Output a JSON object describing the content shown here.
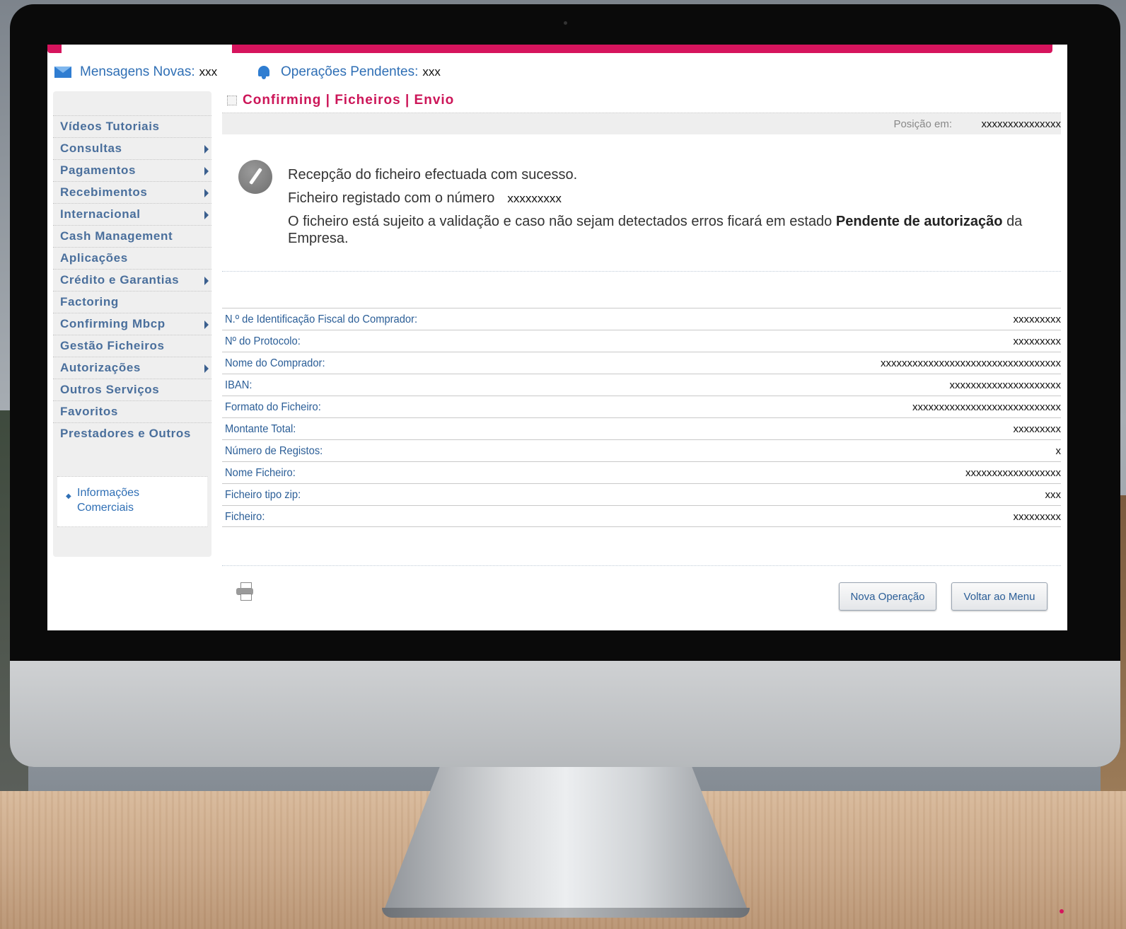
{
  "header": {
    "messages_label": "Mensagens Novas:",
    "messages_value": "xxx",
    "pending_label": "Operações Pendentes:",
    "pending_value": "xxx"
  },
  "page": {
    "title": "Confirming | Ficheiros | Envio",
    "position_label": "Posição em:",
    "position_value": "xxxxxxxxxxxxxxx"
  },
  "sidebar": {
    "items": [
      {
        "label": "Vídeos Tutoriais",
        "has_submenu": false
      },
      {
        "label": "Consultas",
        "has_submenu": true
      },
      {
        "label": "Pagamentos",
        "has_submenu": true
      },
      {
        "label": "Recebimentos",
        "has_submenu": true
      },
      {
        "label": "Internacional",
        "has_submenu": true
      },
      {
        "label": "Cash Management",
        "has_submenu": false
      },
      {
        "label": "Aplicações",
        "has_submenu": false
      },
      {
        "label": "Crédito e Garantias",
        "has_submenu": true
      },
      {
        "label": "Factoring",
        "has_submenu": false
      },
      {
        "label": "Confirming Mbcp",
        "has_submenu": true
      },
      {
        "label": "Gestão Ficheiros",
        "has_submenu": false
      },
      {
        "label": "Autorizações",
        "has_submenu": true
      },
      {
        "label": "Outros Serviços",
        "has_submenu": false
      },
      {
        "label": "Favoritos",
        "has_submenu": false
      },
      {
        "label": "Prestadores e Outros",
        "has_submenu": false
      }
    ],
    "info_link_line1": "Informações",
    "info_link_line2": "Comerciais"
  },
  "message": {
    "line1": "Recepção do ficheiro efectuada com sucesso.",
    "line2": "Ficheiro registado com o número",
    "line2_value": "xxxxxxxxx",
    "line3_pre": "O ficheiro está sujeito a validação e caso não sejam detectados erros ficará em estado",
    "line3_bold": "Pendente de autorização",
    "line3_post": "da Empresa."
  },
  "details": [
    {
      "label": "N.º de Identificação Fiscal do Comprador:",
      "value": "xxxxxxxxx"
    },
    {
      "label": "Nº do Protocolo:",
      "value": "xxxxxxxxx"
    },
    {
      "label": "Nome do Comprador:",
      "value": "xxxxxxxxxxxxxxxxxxxxxxxxxxxxxxxxxx"
    },
    {
      "label": "IBAN:",
      "value": "xxxxxxxxxxxxxxxxxxxxx"
    },
    {
      "label": "Formato do Ficheiro:",
      "value": "xxxxxxxxxxxxxxxxxxxxxxxxxxxx"
    },
    {
      "label": "Montante Total:",
      "value": "xxxxxxxxx"
    },
    {
      "label": "Número de Registos:",
      "value": "x"
    },
    {
      "label": "Nome Ficheiro:",
      "value": "xxxxxxxxxxxxxxxxxx"
    },
    {
      "label": "Ficheiro tipo zip:",
      "value": "xxx"
    },
    {
      "label": "Ficheiro:",
      "value": "xxxxxxxxx"
    }
  ],
  "buttons": {
    "new_operation": "Nova Operação",
    "back_to_menu": "Voltar ao Menu"
  },
  "icons": {
    "messages": "envelope-icon",
    "pending": "bell-icon",
    "message": "pencil-icon",
    "print": "printer-icon"
  },
  "colors": {
    "accent": "#d6145d",
    "link": "#2f6fb5"
  }
}
